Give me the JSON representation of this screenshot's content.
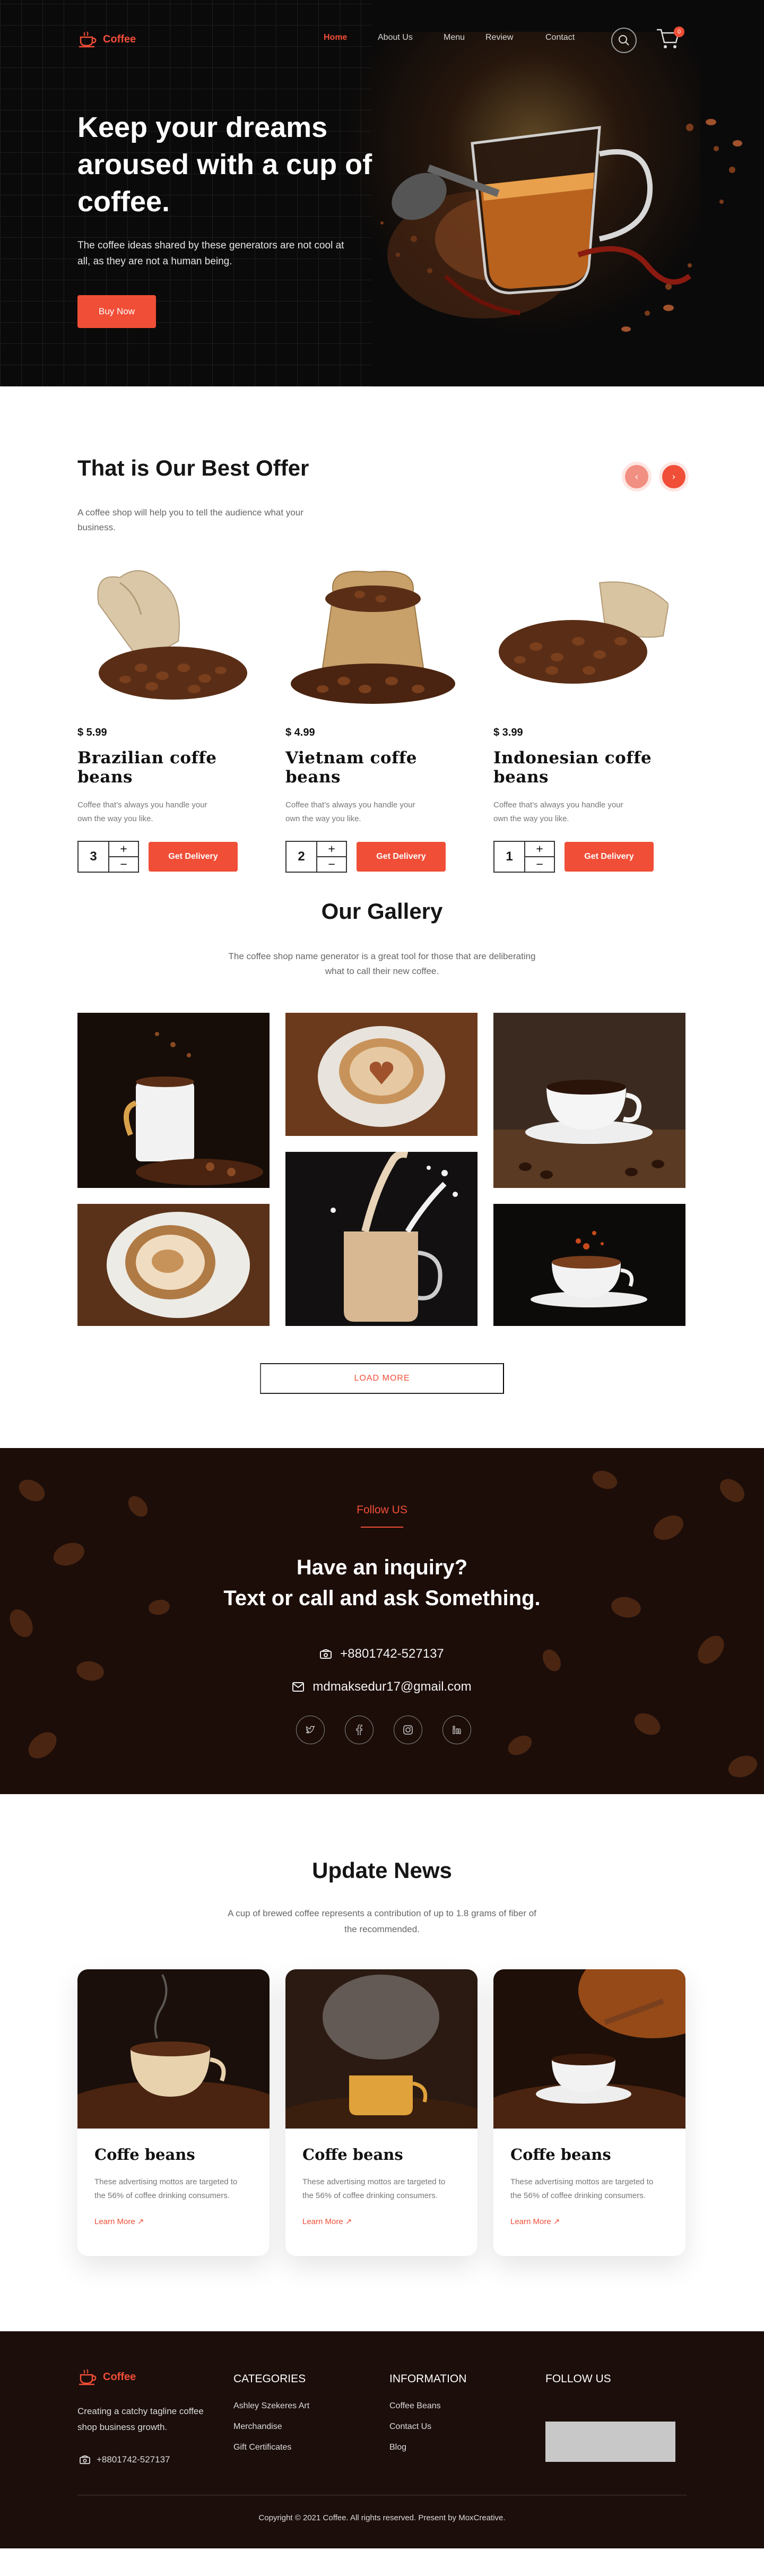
{
  "nav": {
    "logo_text": "Coffee",
    "links": [
      "Home",
      "About Us",
      "Menu",
      "Review",
      "Contact"
    ],
    "cart_count": "0"
  },
  "hero": {
    "title": "Keep your dreams aroused with a cup of coffee.",
    "text": "The coffee ideas shared by these generators are not cool at all, as they are not a human being.",
    "button": "Buy Now"
  },
  "offer": {
    "title": "That is Our Best Offer",
    "subtitle": "A coffee shop will help you to tell the audience what your business.",
    "products": [
      {
        "price": "$ 5.99",
        "name": "Brazilian coffe beans",
        "desc": "Coffee that’s always you handle your own the way you like.",
        "qty": "3",
        "button": "Get Delivery"
      },
      {
        "price": "$ 4.99",
        "name": "Vietnam coffe beans",
        "desc": "Coffee that’s always you handle your own the way you like.",
        "qty": "2",
        "button": "Get Delivery"
      },
      {
        "price": "$ 3.99",
        "name": "Indonesian coffe beans",
        "desc": "Coffee that’s always you handle your own the way you like.",
        "qty": "1",
        "button": "Get Delivery"
      }
    ]
  },
  "gallery": {
    "title": "Our Gallery",
    "subtitle": "The coffee shop name generator is a great tool for those that are deliberating what to call their new coffee.",
    "load_more": "LOAD MORE"
  },
  "follow": {
    "label": "Follow US",
    "heading_line1": "Have an inquiry?",
    "heading_line2": "Text or call and ask Something.",
    "phone": "+8801742-527137",
    "email": "mdmaksedur17@gmail.com",
    "socials": [
      "twitter-icon",
      "facebook-icon",
      "instagram-icon",
      "linkedin-icon"
    ]
  },
  "news": {
    "title": "Update News",
    "subtitle": "A cup of brewed coffee represents a contribution of up to 1.8 grams of fiber of the recommended.",
    "cards": [
      {
        "name": "Coffe beans",
        "text": "These advertising mottos are targeted to the 56% of coffee drinking consumers.",
        "link": "Learn More"
      },
      {
        "name": "Coffe beans",
        "text": "These advertising mottos are targeted to the 56% of coffee drinking consumers.",
        "link": "Learn More"
      },
      {
        "name": "Coffe beans",
        "text": "These advertising mottos are targeted to the 56% of coffee drinking consumers.",
        "link": "Learn More"
      }
    ]
  },
  "footer": {
    "logo_text": "Coffee",
    "tagline": "Creating a catchy tagline coffee shop business growth.",
    "phone": "+8801742-527137",
    "categories": {
      "title": "CATEGORIES",
      "items": [
        "Ashley Szekeres Art",
        "Merchandise",
        "Gift Certificates"
      ]
    },
    "information": {
      "title": "INFORMATION",
      "items": [
        "Coffee Beans",
        "Contact Us",
        "Blog"
      ]
    },
    "follow": {
      "title": "FOLLOW US"
    },
    "copyright": "Copyright © 2021 Coffee. All rights reserved. Present by MoxCreative."
  },
  "colors": {
    "accent": "#f04e37",
    "dark": "#1b0e0b"
  }
}
